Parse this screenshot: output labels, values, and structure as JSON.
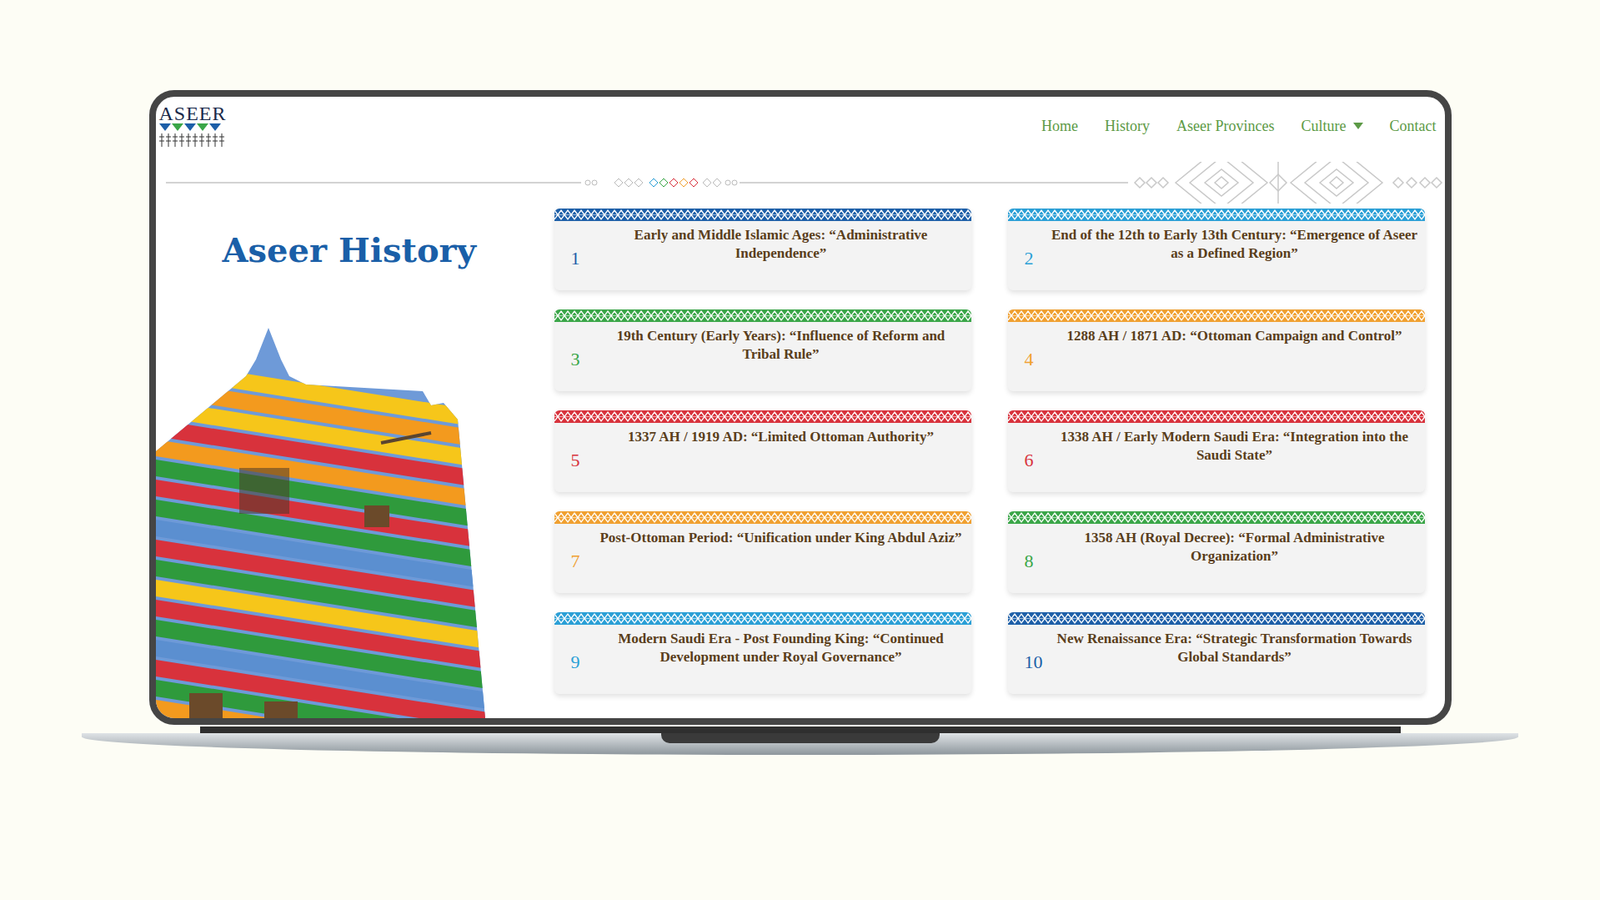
{
  "logo": {
    "text": "ASEER"
  },
  "nav": {
    "items": [
      {
        "label": "Home",
        "selected": false,
        "dropdown": false
      },
      {
        "label": "History",
        "selected": false,
        "dropdown": false
      },
      {
        "label": "Aseer Provinces",
        "selected": false,
        "dropdown": false
      },
      {
        "label": "Culture",
        "selected": false,
        "dropdown": true
      },
      {
        "label": "Contact",
        "selected": false,
        "dropdown": false
      }
    ]
  },
  "page": {
    "title": "Aseer History"
  },
  "timeline": [
    {
      "number": "1",
      "title": "Early and Middle Islamic Ages: “Administrative Independence”",
      "color": "#1d5fa8"
    },
    {
      "number": "2",
      "title": "End of the 12th to Early 13th Century: “Emergence of Aseer as a Defined Region”",
      "color": "#2a9fd6"
    },
    {
      "number": "3",
      "title": "19th Century (Early Years): “Influence of Reform and Tribal Rule”",
      "color": "#3aa648"
    },
    {
      "number": "4",
      "title": "1288 AH / 1871 AD: “Ottoman Campaign and Control”",
      "color": "#f0a030"
    },
    {
      "number": "5",
      "title": "1337 AH / 1919 AD: “Limited Ottoman Authority”",
      "color": "#d8323c"
    },
    {
      "number": "6",
      "title": "1338 AH / Early Modern Saudi Era: “Integration into the Saudi State”",
      "color": "#d8323c"
    },
    {
      "number": "7",
      "title": "Post-Ottoman Period: “Unification under King Abdul Aziz”",
      "color": "#f0a030"
    },
    {
      "number": "8",
      "title": "1358 AH (Royal Decree): “Formal Administrative Organization”",
      "color": "#3aa648"
    },
    {
      "number": "9",
      "title": "Modern Saudi Era - Post Founding King: “Continued Development under Royal Governance”",
      "color": "#2a9fd6"
    },
    {
      "number": "10",
      "title": "New Renaissance Era: “Strategic Transformation Towards Global Standards”",
      "color": "#1d5fa8"
    }
  ]
}
